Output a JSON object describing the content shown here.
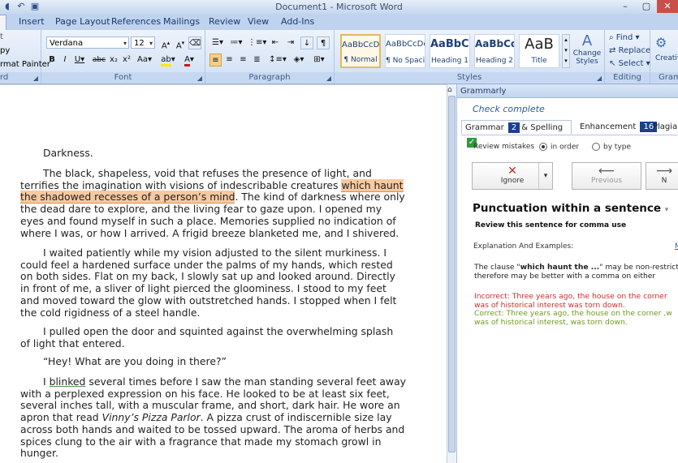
{
  "window": {
    "title": "Document1 - Microsoft Word"
  },
  "tabs": [
    "Insert",
    "Page Layout",
    "References",
    "Mailings",
    "Review",
    "View",
    "Add-Ins"
  ],
  "ribbon": {
    "clipboard": {
      "copy": "py",
      "format_painter": "rmat Painter",
      "label": "rd"
    },
    "font": {
      "name": "Verdana",
      "size": "12",
      "label": "Font"
    },
    "paragraph": {
      "label": "Paragraph"
    },
    "styles": {
      "label": "Styles",
      "items": [
        {
          "preview": "AaBbCcDc",
          "name": "¶ Normal"
        },
        {
          "preview": "AaBbCcDc",
          "name": "¶ No Spaci..."
        },
        {
          "preview": "AaBbCc",
          "name": "Heading 1"
        },
        {
          "preview": "AaBbCc",
          "name": "Heading 2"
        },
        {
          "preview": "AaB",
          "name": "Title"
        }
      ],
      "change_styles": "Change Styles"
    },
    "editing": {
      "find": "Find",
      "replace": "Replace",
      "select": "Select",
      "label": "Editing"
    },
    "creative": {
      "label": "Creativ",
      "group": "Gramm"
    }
  },
  "document": {
    "heading": "Darkness.",
    "p1_before": "The black, shapeless, void that refuses the presence of light, and terrifies the imagination with visions of indescribable creatures ",
    "p1_highlight": "which haunt the shadowed recesses of a person’s mind",
    "p1_after": ". The kind of darkness where only the dead dare to explore, and the living fear to gaze upon. I opened my eyes and found myself in such a place. Memories supplied no indication of where I was, or how I arrived. A frigid breeze blanketed me, and I shivered.",
    "p2": "I waited patiently while my vision adjusted to the silent murkiness. I could feel a hardened surface under the palms of my hands, which rested on both sides. Flat on my back, I slowly sat up and looked around. Directly in front of me, a sliver of light pierced the gloominess. I stood to my feet and moved toward the glow with outstretched hands. I stopped when I felt the cold rigidness of a steel handle.",
    "p3": "I pulled open the door and squinted against the overwhelming splash of light that entered.",
    "p4": "“Hey! What are you doing in there?”",
    "p5_a": "I ",
    "p5_ul": "blinked",
    "p5_b": " several times before I saw the man standing several feet away with a perplexed expression on his face. He looked to be at least six feet, several inches tall, with a muscular frame, and short, dark hair. He wore an apron that read ",
    "p5_italic": "Vinny’s Pizza Parlor",
    "p5_c": ". A pizza crust of indiscernible size lay across both hands and waited to be tossed upward. The aroma of herbs and spices clung to the air with a fragrance that made my stomach growl in hunger."
  },
  "grammarly": {
    "header": "Grammarly",
    "status": "Check complete",
    "tabs": {
      "grammar_label_a": "Grammar",
      "grammar_count": "2",
      "grammar_label_b": "& Spelling",
      "enhancement_label": "Enhancement",
      "enhancement_count": "16",
      "plagiarism_label": "Plagiaris"
    },
    "review_mistakes": "Review mistakes",
    "in_order": "in order",
    "by_type": "by type",
    "ignore": "Ignore",
    "previous": "Previous",
    "next": "N",
    "issue_title": "Punctuation within a sentence",
    "issue_sub": "Review this sentence for comma use",
    "explanation_label": "Explanation And Examples:",
    "explanation_link": "M",
    "explain_a": "The clause \"",
    "explain_bold": "which haunt the ...",
    "explain_b": "\" may be non-restricti and therefore may be better with a comma on either",
    "incorrect": "Incorrect: Three years ago, the house on the corner was of historical interest was torn down.",
    "correct": "Correct: Three years ago, the house on the corner ,w was of historical interest, was torn down.",
    "colors": {
      "incorrect": "#d32b2b",
      "correct": "#6e9a1d"
    }
  }
}
